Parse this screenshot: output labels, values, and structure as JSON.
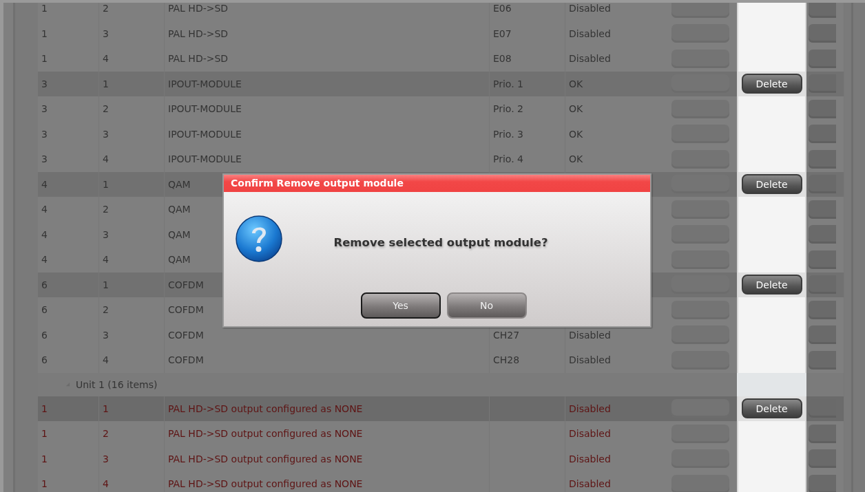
{
  "table": {
    "rows": [
      {
        "kind": "row",
        "module": "1",
        "port": "2",
        "name": "PAL HD->SD",
        "channel": "E06",
        "status": "Disabled",
        "shaded": false,
        "error": false
      },
      {
        "kind": "row",
        "module": "1",
        "port": "3",
        "name": "PAL HD->SD",
        "channel": "E07",
        "status": "Disabled",
        "shaded": false,
        "error": false
      },
      {
        "kind": "row",
        "module": "1",
        "port": "4",
        "name": "PAL HD->SD",
        "channel": "E08",
        "status": "Disabled",
        "shaded": false,
        "error": false
      },
      {
        "kind": "row",
        "module": "3",
        "port": "1",
        "name": "IPOUT-MODULE",
        "channel": "Prio. 1",
        "status": "OK",
        "shaded": true,
        "error": false,
        "action": "Delete"
      },
      {
        "kind": "row",
        "module": "3",
        "port": "2",
        "name": "IPOUT-MODULE",
        "channel": "Prio. 2",
        "status": "OK",
        "shaded": false,
        "error": false
      },
      {
        "kind": "row",
        "module": "3",
        "port": "3",
        "name": "IPOUT-MODULE",
        "channel": "Prio. 3",
        "status": "OK",
        "shaded": false,
        "error": false
      },
      {
        "kind": "row",
        "module": "3",
        "port": "4",
        "name": "IPOUT-MODULE",
        "channel": "Prio. 4",
        "status": "OK",
        "shaded": false,
        "error": false
      },
      {
        "kind": "row",
        "module": "4",
        "port": "1",
        "name": "QAM",
        "shaded": true,
        "error": false,
        "action": "Delete"
      },
      {
        "kind": "row",
        "module": "4",
        "port": "2",
        "name": "QAM",
        "shaded": false,
        "error": false
      },
      {
        "kind": "row",
        "module": "4",
        "port": "3",
        "name": "QAM",
        "shaded": false,
        "error": false
      },
      {
        "kind": "row",
        "module": "4",
        "port": "4",
        "name": "QAM",
        "shaded": false,
        "error": false
      },
      {
        "kind": "row",
        "module": "6",
        "port": "1",
        "name": "COFDM",
        "shaded": true,
        "error": false,
        "action": "Delete"
      },
      {
        "kind": "row",
        "module": "6",
        "port": "2",
        "name": "COFDM",
        "shaded": false,
        "error": false
      },
      {
        "kind": "row",
        "module": "6",
        "port": "3",
        "name": "COFDM",
        "channel": "CH27",
        "status": "Disabled",
        "shaded": false,
        "error": false
      },
      {
        "kind": "row",
        "module": "6",
        "port": "4",
        "name": "COFDM",
        "channel": "CH28",
        "status": "Disabled",
        "shaded": false,
        "error": false
      },
      {
        "kind": "group",
        "label": "Unit 1 (16 items)",
        "expanded": true
      },
      {
        "kind": "row",
        "module": "1",
        "port": "1",
        "name": "PAL HD->SD output configured as NONE",
        "status": "Disabled",
        "shaded": true,
        "error": true,
        "action": "Delete"
      },
      {
        "kind": "row",
        "module": "1",
        "port": "2",
        "name": "PAL HD->SD output configured as NONE",
        "status": "Disabled",
        "shaded": false,
        "error": true
      },
      {
        "kind": "row",
        "module": "1",
        "port": "3",
        "name": "PAL HD->SD output configured as NONE",
        "status": "Disabled",
        "shaded": false,
        "error": true
      },
      {
        "kind": "row",
        "module": "1",
        "port": "4",
        "name": "PAL HD->SD output configured as NONE",
        "status": "Disabled",
        "shaded": false,
        "error": true
      }
    ]
  },
  "dialog": {
    "title": "Confirm Remove output module",
    "message": "Remove selected output module?",
    "buttons": [
      {
        "label": "Yes",
        "focused": true
      },
      {
        "label": "No",
        "focused": false
      }
    ]
  }
}
